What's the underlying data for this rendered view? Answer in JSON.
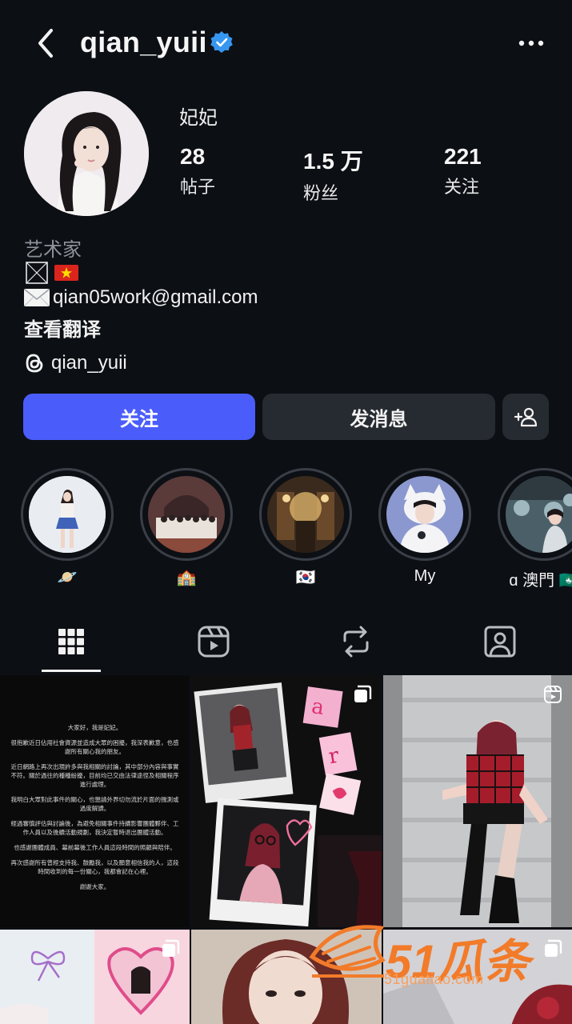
{
  "header": {
    "username": "qian_yuii",
    "verified": true
  },
  "profile": {
    "display_name": "妃妃",
    "stats": [
      {
        "value": "28",
        "label": "帖子"
      },
      {
        "value": "1.5 万",
        "label": "粉丝"
      },
      {
        "value": "221",
        "label": "关注"
      }
    ]
  },
  "bio": {
    "category": "艺术家",
    "email": "qian05work@gmail.com",
    "translate_link": "查看翻译",
    "threads_handle": "qian_yuii"
  },
  "actions": {
    "follow_label": "关注",
    "message_label": "发消息"
  },
  "highlights": [
    {
      "caption": "🪐",
      "bg": "#e8eef5",
      "accent": "#3f63b8"
    },
    {
      "caption": "🏫",
      "bg": "#5a3b3a",
      "accent": "#e9e2da"
    },
    {
      "caption": "🇰🇷",
      "bg": "#3a2a1d",
      "accent": "#d9b06a"
    },
    {
      "caption": "My",
      "bg": "#9aa7d6",
      "accent": "#ffffff"
    },
    {
      "caption": "ɑ 澳門 🇲🇴",
      "bg": "#4b5f68",
      "accent": "#9fb7bf"
    }
  ],
  "tabs": [
    {
      "name": "grid",
      "icon": "grid-icon",
      "active": true
    },
    {
      "name": "reels",
      "icon": "reels-icon",
      "active": false
    },
    {
      "name": "reposts",
      "icon": "repost-icon",
      "active": false
    },
    {
      "name": "tagged",
      "icon": "tagged-icon",
      "active": false
    }
  ],
  "posts": {
    "statement": [
      "大家好，我是妃妃。",
      "很抱歉近日佔用社會資源並造成大眾的困擾，我深表歉意，也感謝所有關心我的朋友。",
      "近日網路上再次出現許多與我相關的討論，其中部分內容與事實不符。關於過往的種種紛擾，目前均已交由法律途徑及相關程序進行處理。",
      "我明白大眾對此事件的關心，也懇請外界切勿流於片面的揣測或過度解讀。",
      "經過審慎評估與討論後，為避免相關事件持續影響團體夥伴、工作人員以及後續活動規劃，我決定暫時退出團體活動。",
      "也感謝團體成員、幕前幕後工作人員這段時間的照顧與陪伴。",
      "再次感謝所有曾經支持我、鼓勵我，以及願意相信我的人，這段時間收到的每一份關心，我都會記在心裡。",
      "謝謝大家。"
    ]
  },
  "watermark": {
    "brand": "51瓜条",
    "url": "51guatiao.com"
  },
  "colors": {
    "background": "#0c0f14",
    "primary_button": "#4a5dfa",
    "secondary_button": "#262a31",
    "verified": "#3797f0",
    "muted_text": "#8d929a"
  }
}
